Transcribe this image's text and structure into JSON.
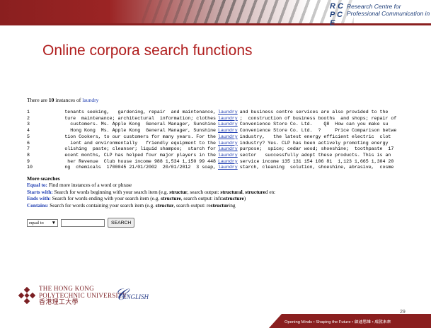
{
  "header": {
    "rc_logo": "R C\nP C E",
    "rc_line1": "Research Centre for",
    "rc_line2": "Professional Communication in English"
  },
  "slide": {
    "title": "Online corpora search functions",
    "instances_prefix": "There are",
    "instances_count": "10",
    "instances_mid": "instances of",
    "keyword": "laundry"
  },
  "concordance": [
    {
      "n": "1",
      "left": "tenants seeking,   gardening, repair  and maintenance,",
      "kw": "laundry",
      "right": "and business centre services are also provided to the"
    },
    {
      "n": "2",
      "left": "ture  maintenance; architectural  information; clothes",
      "kw": "laundry",
      "right": ";  construction of business booths  and shops; repair of"
    },
    {
      "n": "3",
      "left": "customers. Ms. Apple Kong  General Manager, Sunshine",
      "kw": "Laundry",
      "right": "Convenience Store Co. Ltd.    Q8  How can you make su"
    },
    {
      "n": "4",
      "left": "Hong Kong  Ms. Apple Kong  General Manager, Sunshine",
      "kw": "Laundry",
      "right": "Convenience Store Co. Ltd.  ?     Price Comparison betwe"
    },
    {
      "n": "5",
      "left": "tion Cookers, to our customers for many years. For the",
      "kw": "laundry",
      "right": "industry,   the latest energy efficient electric  clot"
    },
    {
      "n": "6",
      "left": "ient and environmentally   friendly equipment to the",
      "kw": "laundry",
      "right": "industry? Yes. CLP has been actively promoting energy"
    },
    {
      "n": "7",
      "left": "olishing  paste; cleanser; liquid shampoo;  starch for",
      "kw": "laundry",
      "right": "purpose;  spice; cedar wood; shoeshine;  toothpaste  17"
    },
    {
      "n": "8",
      "left": "ecent months, CLP has helped four major players in the",
      "kw": "laundry",
      "right": "sector   successfully adopt these products. This is an"
    },
    {
      "n": "9",
      "left": "her Revenue  Club house income 988 1,534 1,150 99 448",
      "kw": "Laundry",
      "right": "service income 135 131 154 106 81  1,123 1,665 1,304 20"
    },
    {
      "n": "10",
      "left": "ng  chemicals  1700045 21/01/2002  20/01/2012  3 soap,",
      "kw": "laundry",
      "right": "starch, cleaning  solution, shoeshine, abrasive,  cosme"
    }
  ],
  "more_searches": {
    "title": "More searches",
    "items": [
      {
        "name": "Equal to:",
        "desc": " Find more instances of a word or phrase"
      },
      {
        "name": "Starts with:",
        "desc": " Search for words beginning with your search item (e.g. ",
        "ex": "structur",
        "desc2": ", search output: ",
        "out": "structural",
        "desc3": ", ",
        "out2": "structure",
        "desc4": "d etc"
      },
      {
        "name": "Ends with:",
        "desc": " Search for words ending with your search item (e.g. ",
        "ex": "structure",
        "desc2": ", search output: infra",
        "out": "structure",
        "desc3": "",
        "out2": "",
        "desc4": ""
      },
      {
        "name": "Contains:",
        "desc": " Search for words containing your search item (e.g. ",
        "ex": "structur",
        "desc2": ", search output: re",
        "out": "structur",
        "desc3": "ing",
        "out2": "",
        "desc4": ""
      }
    ]
  },
  "form": {
    "select_value": "equal to",
    "input_value": "",
    "button_label": "SEARCH"
  },
  "footer": {
    "polyu_line1": "THE HONG KONG",
    "polyu_line2": "POLYTECHNIC UNIVERSITY",
    "polyu_line3": "香港理工大學",
    "english_logo": "ENGLISH",
    "page_number": "29",
    "tagline": "Opening Minds • Shaping the Future • 啟迪思維 • 成就未來"
  },
  "colors": {
    "accent": "#8a1f1f",
    "title": "#b01e1e",
    "link": "#1b3ab0"
  }
}
